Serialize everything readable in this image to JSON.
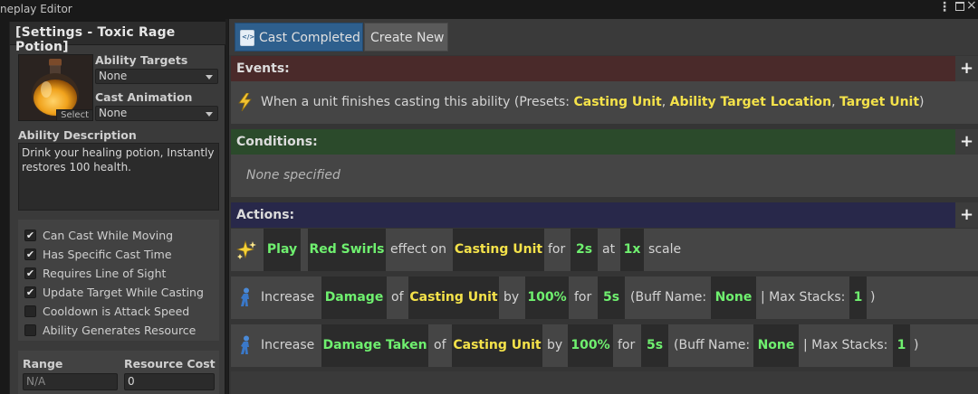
{
  "window": {
    "title": "neplay Editor"
  },
  "left": {
    "header": "[Settings - Toxic Rage Potion]",
    "select_label": "Select",
    "ability_targets": {
      "label": "Ability Targets",
      "value": "None"
    },
    "cast_animation": {
      "label": "Cast Animation",
      "value": "None"
    },
    "ability_description": {
      "label": "Ability Description",
      "value": "Drink your healing potion, Instantly restores 100 health."
    },
    "checkboxes": [
      {
        "label": "Can Cast While Moving",
        "checked": true,
        "mark": "✔"
      },
      {
        "label": "Has Specific Cast Time",
        "checked": true,
        "mark": "✔"
      },
      {
        "label": "Requires Line of Sight",
        "checked": true,
        "mark": "✔"
      },
      {
        "label": "Update Target While Casting",
        "checked": true,
        "mark": "✔"
      },
      {
        "label": "Cooldown is Attack Speed",
        "checked": false,
        "mark": ""
      },
      {
        "label": "Ability Generates Resource",
        "checked": false,
        "mark": ""
      }
    ],
    "range": {
      "label": "Range",
      "value": "N/A"
    },
    "resource_cost": {
      "label": "Resource Cost",
      "value": "0"
    }
  },
  "tabs": [
    {
      "label": "Cast Completed",
      "active": true
    },
    {
      "label": "Create New",
      "active": false
    }
  ],
  "events": {
    "title": "Events:",
    "plus": "+",
    "row": {
      "prefix": "When a unit finishes casting this ability (Presets: ",
      "preset1": "Casting Unit",
      "sep1": ",",
      "preset2": "Ability Target Location",
      "sep2": ",",
      "preset3": "Target Unit",
      "suffix": ")"
    }
  },
  "conditions": {
    "title": "Conditions:",
    "plus": "+",
    "empty_text": "None specified"
  },
  "actions": {
    "title": "Actions:",
    "plus": "+",
    "action1": {
      "verb": "Play",
      "effect": "Red Swirls",
      "t1": "effect on",
      "target": "Casting Unit",
      "t2": "for",
      "duration": "2s",
      "t3": "at",
      "scale": "1x",
      "t4": "scale"
    },
    "action2": {
      "verb": "Increase",
      "stat": "Damage",
      "t1": "of",
      "target": "Casting Unit",
      "t2": "by",
      "amount": "100%",
      "t3": "for",
      "duration": "5s",
      "t4": "(Buff Name:",
      "buff_name": "None",
      "t5": "| Max Stacks:",
      "max_stacks": "1",
      "t6": ")"
    },
    "action3": {
      "verb": "Increase",
      "stat": "Damage Taken",
      "t1": "of",
      "target": "Casting Unit",
      "t2": "by",
      "amount": "100%",
      "t3": "for",
      "duration": "5s",
      "t4": "(Buff Name:",
      "buff_name": "None",
      "t5": "| Max Stacks:",
      "max_stacks": "1",
      "t6": ")"
    }
  },
  "colors": {
    "events_header": "#4a2a2a",
    "conditions_header": "#2b4a2b",
    "actions_header": "#28284a",
    "tab_active": "#2e5f8d",
    "preset_yellow": "#f4e24a",
    "value_green": "#6ff06f"
  }
}
